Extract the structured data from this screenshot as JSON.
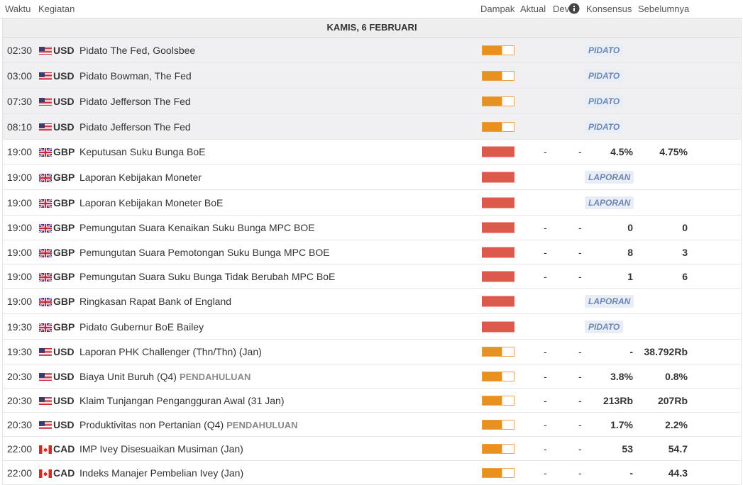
{
  "columns": {
    "waktu": "Waktu",
    "kegiatan": "Kegiatan",
    "dampak": "Dampak",
    "aktual": "Aktual",
    "dev": "Dev",
    "konsensus": "Konsensus",
    "sebelumnya": "Sebelumnya"
  },
  "day_label": "KAMIS, 6 FEBRUARI",
  "rows": [
    {
      "time": "02:30",
      "flag": "US",
      "currency": "USD",
      "event": "Pidato The Fed, Goolsbee",
      "prelim": "",
      "impact": "medium",
      "badge": "PIDATO",
      "actual": "",
      "dev": "",
      "consensus": "",
      "previous": "",
      "grey": true
    },
    {
      "time": "03:00",
      "flag": "US",
      "currency": "USD",
      "event": "Pidato Bowman, The Fed",
      "prelim": "",
      "impact": "medium",
      "badge": "PIDATO",
      "actual": "",
      "dev": "",
      "consensus": "",
      "previous": "",
      "grey": true
    },
    {
      "time": "07:30",
      "flag": "US",
      "currency": "USD",
      "event": "Pidato Jefferson The Fed",
      "prelim": "",
      "impact": "medium",
      "badge": "PIDATO",
      "actual": "",
      "dev": "",
      "consensus": "",
      "previous": "",
      "grey": true
    },
    {
      "time": "08:10",
      "flag": "US",
      "currency": "USD",
      "event": "Pidato Jefferson The Fed",
      "prelim": "",
      "impact": "medium",
      "badge": "PIDATO",
      "actual": "",
      "dev": "",
      "consensus": "",
      "previous": "",
      "grey": true
    },
    {
      "time": "19:00",
      "flag": "UK",
      "currency": "GBP",
      "event": "Keputusan Suku Bunga BoE",
      "prelim": "",
      "impact": "high",
      "badge": "",
      "actual": "-",
      "dev": "-",
      "consensus": "4.5%",
      "previous": "4.75%",
      "grey": false
    },
    {
      "time": "19:00",
      "flag": "UK",
      "currency": "GBP",
      "event": "Laporan Kebijakan Moneter",
      "prelim": "",
      "impact": "high",
      "badge": "LAPORAN",
      "actual": "",
      "dev": "",
      "consensus": "",
      "previous": "",
      "grey": false
    },
    {
      "time": "19:00",
      "flag": "UK",
      "currency": "GBP",
      "event": "Laporan Kebijakan Moneter BoE",
      "prelim": "",
      "impact": "high",
      "badge": "LAPORAN",
      "actual": "",
      "dev": "",
      "consensus": "",
      "previous": "",
      "grey": false
    },
    {
      "time": "19:00",
      "flag": "UK",
      "currency": "GBP",
      "event": "Pemungutan Suara Kenaikan Suku Bunga MPC BOE",
      "prelim": "",
      "impact": "high",
      "badge": "",
      "actual": "-",
      "dev": "-",
      "consensus": "0",
      "previous": "0",
      "grey": false
    },
    {
      "time": "19:00",
      "flag": "UK",
      "currency": "GBP",
      "event": "Pemungutan Suara Pemotongan Suku Bunga MPC BOE",
      "prelim": "",
      "impact": "high",
      "badge": "",
      "actual": "-",
      "dev": "-",
      "consensus": "8",
      "previous": "3",
      "grey": false
    },
    {
      "time": "19:00",
      "flag": "UK",
      "currency": "GBP",
      "event": "Pemungutan Suara Suku Bunga Tidak Berubah MPC BoE",
      "prelim": "",
      "impact": "high",
      "badge": "",
      "actual": "-",
      "dev": "-",
      "consensus": "1",
      "previous": "6",
      "grey": false
    },
    {
      "time": "19:00",
      "flag": "UK",
      "currency": "GBP",
      "event": "Ringkasan Rapat Bank of England",
      "prelim": "",
      "impact": "high",
      "badge": "LAPORAN",
      "actual": "",
      "dev": "",
      "consensus": "",
      "previous": "",
      "grey": false
    },
    {
      "time": "19:30",
      "flag": "UK",
      "currency": "GBP",
      "event": "Pidato Gubernur BoE Bailey",
      "prelim": "",
      "impact": "high",
      "badge": "PIDATO",
      "actual": "",
      "dev": "",
      "consensus": "",
      "previous": "",
      "grey": false
    },
    {
      "time": "19:30",
      "flag": "US",
      "currency": "USD",
      "event": "Laporan PHK Challenger (Thn/Thn) (Jan)",
      "prelim": "",
      "impact": "medium",
      "badge": "",
      "actual": "-",
      "dev": "-",
      "consensus": "-",
      "previous": "38.792Rb",
      "grey": false
    },
    {
      "time": "20:30",
      "flag": "US",
      "currency": "USD",
      "event": "Biaya Unit Buruh (Q4)",
      "prelim": "PENDAHULUAN",
      "impact": "medium",
      "badge": "",
      "actual": "-",
      "dev": "-",
      "consensus": "3.8%",
      "previous": "0.8%",
      "grey": false
    },
    {
      "time": "20:30",
      "flag": "US",
      "currency": "USD",
      "event": "Klaim Tunjangan Pengangguran Awal (31 Jan)",
      "prelim": "",
      "impact": "medium",
      "badge": "",
      "actual": "-",
      "dev": "-",
      "consensus": "213Rb",
      "previous": "207Rb",
      "grey": false
    },
    {
      "time": "20:30",
      "flag": "US",
      "currency": "USD",
      "event": "Produktivitas non Pertanian (Q4)",
      "prelim": "PENDAHULUAN",
      "impact": "medium",
      "badge": "",
      "actual": "-",
      "dev": "-",
      "consensus": "1.7%",
      "previous": "2.2%",
      "grey": false
    },
    {
      "time": "22:00",
      "flag": "CA",
      "currency": "CAD",
      "event": "IMP Ivey Disesuaikan Musiman (Jan)",
      "prelim": "",
      "impact": "medium",
      "badge": "",
      "actual": "-",
      "dev": "-",
      "consensus": "53",
      "previous": "54.7",
      "grey": false
    },
    {
      "time": "22:00",
      "flag": "CA",
      "currency": "CAD",
      "event": "Indeks Manajer Pembelian Ivey (Jan)",
      "prelim": "",
      "impact": "medium",
      "badge": "",
      "actual": "-",
      "dev": "-",
      "consensus": "-",
      "previous": "44.3",
      "grey": false
    }
  ],
  "colors": {
    "impact_high": "#dc5a4c",
    "impact_medium": "#e8911f",
    "badge_text": "#6a87b4",
    "badge_bg": "#e9eef6"
  }
}
